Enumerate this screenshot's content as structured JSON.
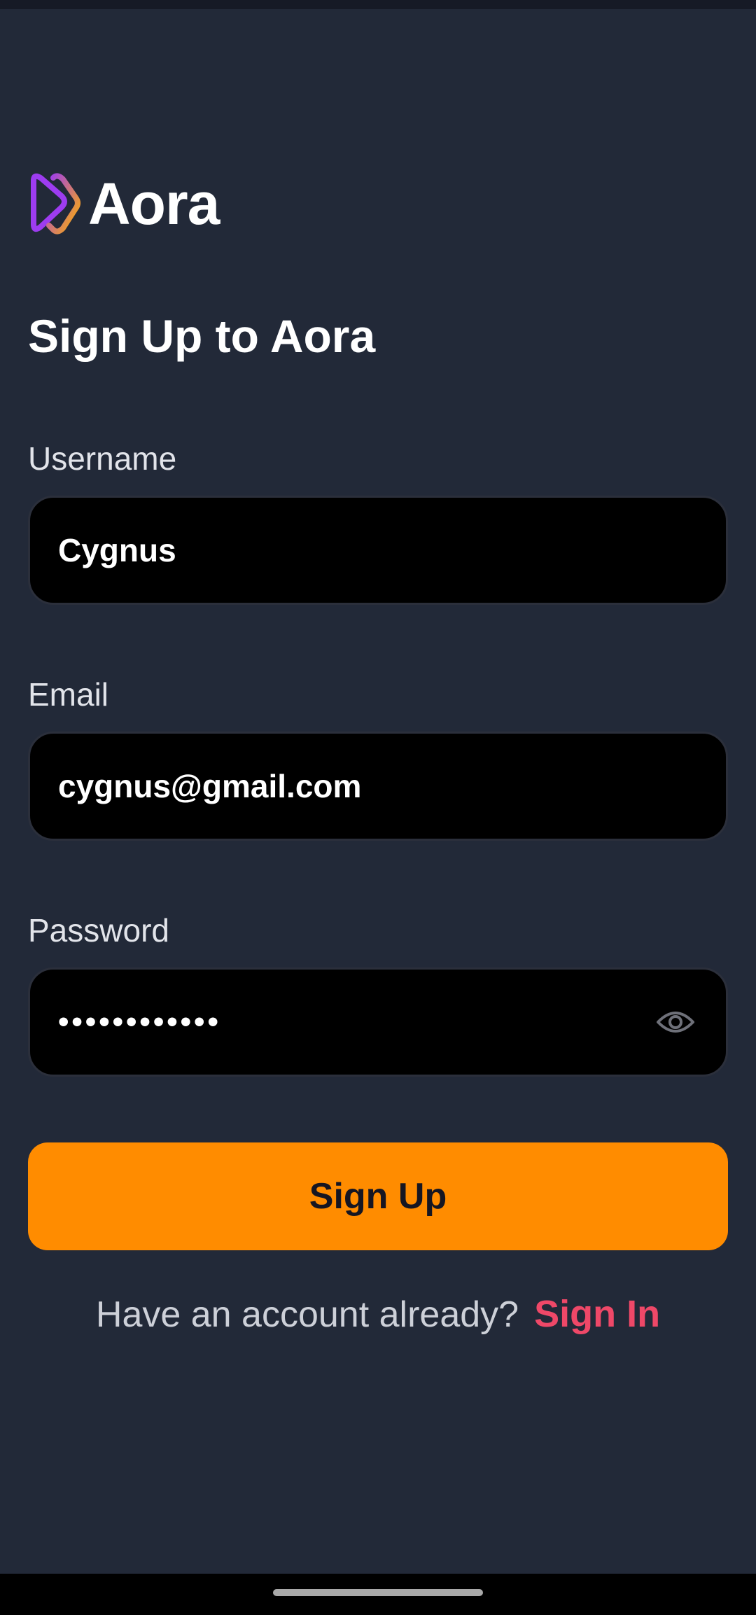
{
  "app": {
    "logo_text": "Aora"
  },
  "page": {
    "title": "Sign Up to Aora"
  },
  "form": {
    "username": {
      "label": "Username",
      "value": "Cygnus"
    },
    "email": {
      "label": "Email",
      "value": "cygnus@gmail.com"
    },
    "password": {
      "label": "Password",
      "masked_value": "••••••••••••"
    },
    "submit_label": "Sign Up"
  },
  "footer": {
    "prompt": "Have an account already?",
    "link": "Sign In"
  },
  "colors": {
    "background": "#222938",
    "accent": "#ff8c00",
    "link": "#ef4868",
    "logo_gradient": [
      "#9d3cf0",
      "#ffb100"
    ]
  },
  "icons": {
    "logo": "play-logo-icon",
    "password_toggle": "eye-icon"
  }
}
